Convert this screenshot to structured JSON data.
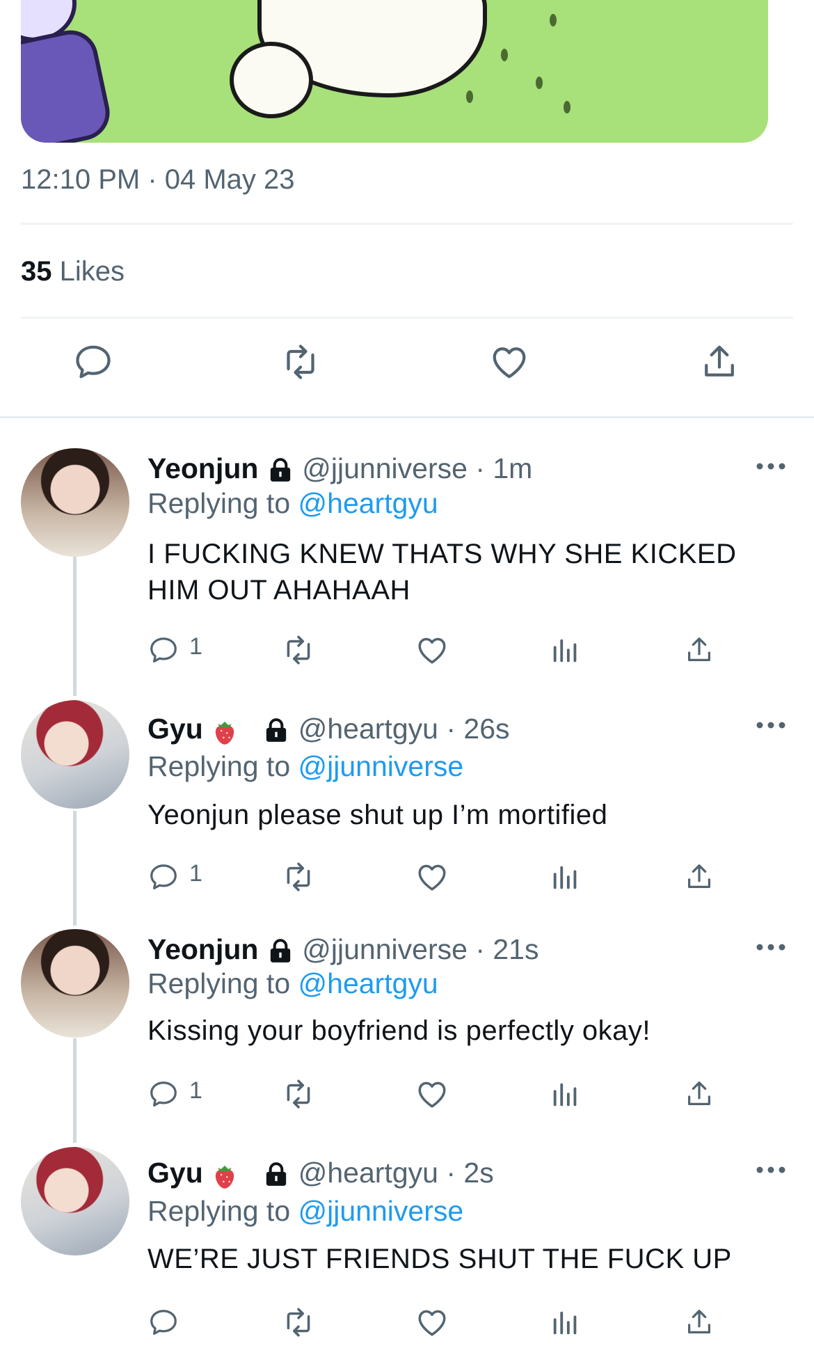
{
  "tweet": {
    "timestamp": "12:10 PM · 04 May 23",
    "likes_count": "35",
    "likes_label": "Likes",
    "actions": [
      "reply-icon",
      "retweet-icon",
      "like-icon",
      "share-icon"
    ]
  },
  "replies": [
    {
      "name": "Yeonjun",
      "has_strawberry": false,
      "handle": "@jjunniverse",
      "time": "1m",
      "replying_prefix": "Replying to",
      "replying_to": "@heartgyu",
      "text": "I FUCKING KNEW THATS WHY SHE KICKED HIM OUT AHAHAAH",
      "reply_count": "1"
    },
    {
      "name": "Gyu",
      "has_strawberry": true,
      "handle": "@heartgyu",
      "time": "26s",
      "replying_prefix": "Replying to",
      "replying_to": "@jjunniverse",
      "text": "Yeonjun please shut up I’m mortified",
      "reply_count": "1"
    },
    {
      "name": "Yeonjun",
      "has_strawberry": false,
      "handle": "@jjunniverse",
      "time": "21s",
      "replying_prefix": "Replying to",
      "replying_to": "@heartgyu",
      "text": "Kissing your boyfriend is perfectly okay!",
      "reply_count": "1"
    },
    {
      "name": "Gyu",
      "has_strawberry": true,
      "handle": "@heartgyu",
      "time": "2s",
      "replying_prefix": "Replying to",
      "replying_to": "@jjunniverse",
      "text": "WE’RE JUST FRIENDS SHUT THE FUCK UP",
      "reply_count": ""
    }
  ],
  "colors": {
    "link": "#1d9bf0",
    "muted": "#536471",
    "text": "#0f1419"
  }
}
